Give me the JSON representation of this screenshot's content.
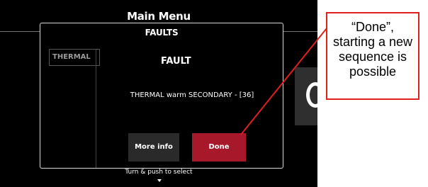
{
  "background": {
    "title": "Main Menu",
    "left_tab": "THERMAL"
  },
  "dialog": {
    "title": "FAULTS",
    "heading": "FAULT",
    "message": "THERMAL warm SECONDARY - [36]",
    "buttons": {
      "more_info": "More info",
      "done": "Done"
    }
  },
  "footer": {
    "hint": "Turn & push to select",
    "arrow_icon": "chevron-down-icon"
  },
  "annotation": {
    "lines": [
      "“Done”,",
      "starting a new",
      "sequence is",
      "possible"
    ],
    "color": "#e0201c"
  },
  "colors": {
    "done_button": "#a8182b",
    "more_info_button": "#2a2a2a",
    "screen_bg": "#000000"
  }
}
